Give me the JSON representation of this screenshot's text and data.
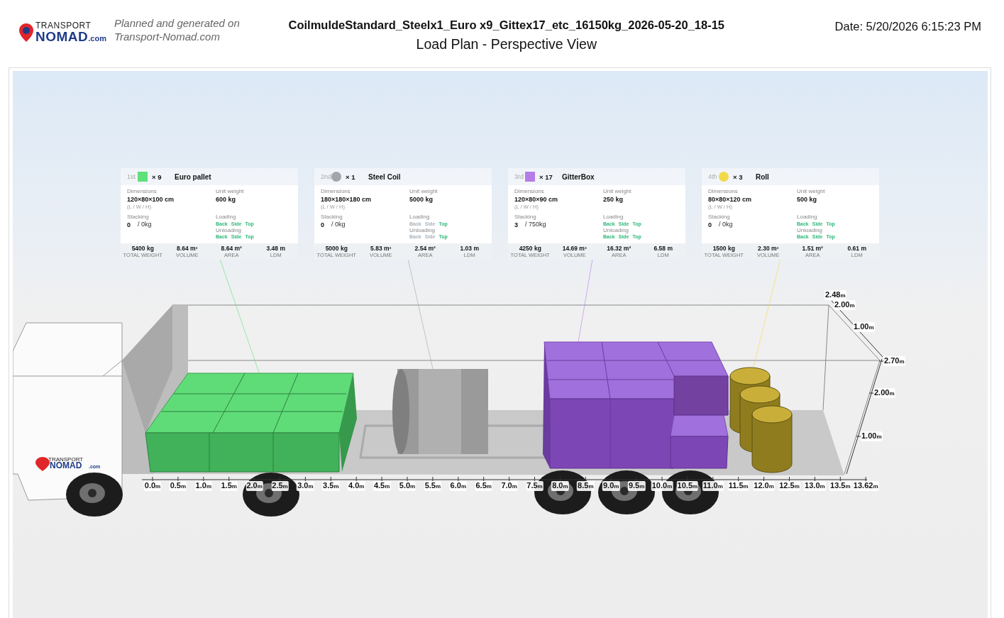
{
  "header": {
    "logo": {
      "line1": "TRANSPORT",
      "name": "NOMAD",
      "suffix": ".com"
    },
    "tagline": [
      "Planned and generated on",
      "Transport-Nomad.com"
    ],
    "title": "CoilmuldeStandard_Steelx1_Euro x9_Gittex17_etc_16150kg_2026-05-20_18-15",
    "subtitle": "Load Plan - Perspective View",
    "date": "Date: 5/20/2026 6:15:23 PM"
  },
  "cargo": [
    {
      "rank": "1st",
      "kind": "box",
      "color": "#5ee07a",
      "count": "× 9",
      "name": "Euro pallet",
      "dimensions_label": "Dimensions",
      "dimensions": "120×80×100 cm",
      "dimensions_note": "(L / W / H)",
      "weight_label": "Unit weight",
      "weight": "600 kg",
      "stacking_label": "Stacking",
      "stacking": "0",
      "stacking_load": "/ 0kg",
      "loading_label": "Loading",
      "loading": [
        {
          "label": "Back",
          "on": true
        },
        {
          "label": "Side",
          "on": true
        },
        {
          "label": "Top",
          "on": true
        }
      ],
      "unloading_label": "Unloading",
      "unloading": [
        {
          "label": "Back",
          "on": true
        },
        {
          "label": "Side",
          "on": true
        },
        {
          "label": "Top",
          "on": true
        }
      ],
      "stats": [
        {
          "value": "5400 kg",
          "label": "TOTAL WEIGHT"
        },
        {
          "value": "8.64 m³",
          "label": "VOLUME"
        },
        {
          "value": "8.64 m²",
          "label": "AREA"
        },
        {
          "value": "3.48 m",
          "label": "LDM"
        }
      ]
    },
    {
      "rank": "2nd",
      "kind": "cylinder",
      "color": "#a3a5ab",
      "count": "× 1",
      "name": "Steel Coil",
      "dimensions_label": "Dimensions",
      "dimensions": "180×180×180 cm",
      "dimensions_note": "(L / W / H)",
      "weight_label": "Unit weight",
      "weight": "5000 kg",
      "stacking_label": "Stacking",
      "stacking": "0",
      "stacking_load": "/ 0kg",
      "loading_label": "Loading",
      "loading": [
        {
          "label": "Back",
          "on": false
        },
        {
          "label": "Side",
          "on": false
        },
        {
          "label": "Top",
          "on": true
        }
      ],
      "unloading_label": "Unloading",
      "unloading": [
        {
          "label": "Back",
          "on": false
        },
        {
          "label": "Side",
          "on": false
        },
        {
          "label": "Top",
          "on": true
        }
      ],
      "stats": [
        {
          "value": "5000 kg",
          "label": "TOTAL WEIGHT"
        },
        {
          "value": "5.83 m³",
          "label": "VOLUME"
        },
        {
          "value": "2.54 m²",
          "label": "AREA"
        },
        {
          "value": "1.03 m",
          "label": "LDM"
        }
      ]
    },
    {
      "rank": "3rd",
      "kind": "box",
      "color": "#b57ee6",
      "count": "× 17",
      "name": "GitterBox",
      "dimensions_label": "Dimensions",
      "dimensions": "120×80×90 cm",
      "dimensions_note": "(L / W / H)",
      "weight_label": "Unit weight",
      "weight": "250 kg",
      "stacking_label": "Stacking",
      "stacking": "3",
      "stacking_load": "/ 750kg",
      "loading_label": "Loading",
      "loading": [
        {
          "label": "Back",
          "on": true
        },
        {
          "label": "Side",
          "on": true
        },
        {
          "label": "Top",
          "on": true
        }
      ],
      "unloading_label": "Unloading",
      "unloading": [
        {
          "label": "Back",
          "on": true
        },
        {
          "label": "Side",
          "on": true
        },
        {
          "label": "Top",
          "on": true
        }
      ],
      "stats": [
        {
          "value": "4250 kg",
          "label": "TOTAL WEIGHT"
        },
        {
          "value": "14.69 m³",
          "label": "VOLUME"
        },
        {
          "value": "16.32 m²",
          "label": "AREA"
        },
        {
          "value": "6.58 m",
          "label": "LDM"
        }
      ]
    },
    {
      "rank": "4th",
      "kind": "cylinder",
      "color": "#f2d94a",
      "count": "× 3",
      "name": "Roll",
      "dimensions_label": "Dimensions",
      "dimensions": "80×80×120 cm",
      "dimensions_note": "(L / W / H)",
      "weight_label": "Unit weight",
      "weight": "500 kg",
      "stacking_label": "Stacking",
      "stacking": "0",
      "stacking_load": "/ 0kg",
      "loading_label": "Loading",
      "loading": [
        {
          "label": "Back",
          "on": true
        },
        {
          "label": "Side",
          "on": true
        },
        {
          "label": "Top",
          "on": true
        }
      ],
      "unloading_label": "Unloading",
      "unloading": [
        {
          "label": "Back",
          "on": true
        },
        {
          "label": "Side",
          "on": true
        },
        {
          "label": "Top",
          "on": true
        }
      ],
      "stats": [
        {
          "value": "1500 kg",
          "label": "TOTAL WEIGHT"
        },
        {
          "value": "2.30 m³",
          "label": "VOLUME"
        },
        {
          "value": "1.51 m²",
          "label": "AREA"
        },
        {
          "value": "0.61 m",
          "label": "LDM"
        }
      ]
    }
  ],
  "truck_logo": {
    "line1": "TRANSPORT",
    "name": "NOMAD",
    "suffix": ".com"
  },
  "axes": {
    "length": [
      {
        "value": "0.0",
        "unit": "m"
      },
      {
        "value": "0.5",
        "unit": "m"
      },
      {
        "value": "1.0",
        "unit": "m"
      },
      {
        "value": "1.5",
        "unit": "m"
      },
      {
        "value": "2.0",
        "unit": "m"
      },
      {
        "value": "2.5",
        "unit": "m"
      },
      {
        "value": "3.0",
        "unit": "m"
      },
      {
        "value": "3.5",
        "unit": "m"
      },
      {
        "value": "4.0",
        "unit": "m"
      },
      {
        "value": "4.5",
        "unit": "m"
      },
      {
        "value": "5.0",
        "unit": "m"
      },
      {
        "value": "5.5",
        "unit": "m"
      },
      {
        "value": "6.0",
        "unit": "m"
      },
      {
        "value": "6.5",
        "unit": "m"
      },
      {
        "value": "7.0",
        "unit": "m"
      },
      {
        "value": "7.5",
        "unit": "m"
      },
      {
        "value": "8.0",
        "unit": "m"
      },
      {
        "value": "8.5",
        "unit": "m"
      },
      {
        "value": "9.0",
        "unit": "m"
      },
      {
        "value": "9.5",
        "unit": "m"
      },
      {
        "value": "10.0",
        "unit": "m"
      },
      {
        "value": "10.5",
        "unit": "m"
      },
      {
        "value": "11.0",
        "unit": "m"
      },
      {
        "value": "11.5",
        "unit": "m"
      },
      {
        "value": "12.0",
        "unit": "m"
      },
      {
        "value": "12.5",
        "unit": "m"
      },
      {
        "value": "13.0",
        "unit": "m"
      },
      {
        "value": "13.5",
        "unit": "m"
      },
      {
        "value": "13.62",
        "unit": "m"
      }
    ],
    "height": [
      {
        "value": "2.70",
        "unit": "m"
      },
      {
        "value": "2.00",
        "unit": "m"
      },
      {
        "value": "1.00",
        "unit": "m"
      }
    ],
    "width": [
      {
        "value": "2.48",
        "unit": "m"
      },
      {
        "value": "2.00",
        "unit": "m"
      },
      {
        "value": "1.00",
        "unit": "m"
      }
    ]
  }
}
